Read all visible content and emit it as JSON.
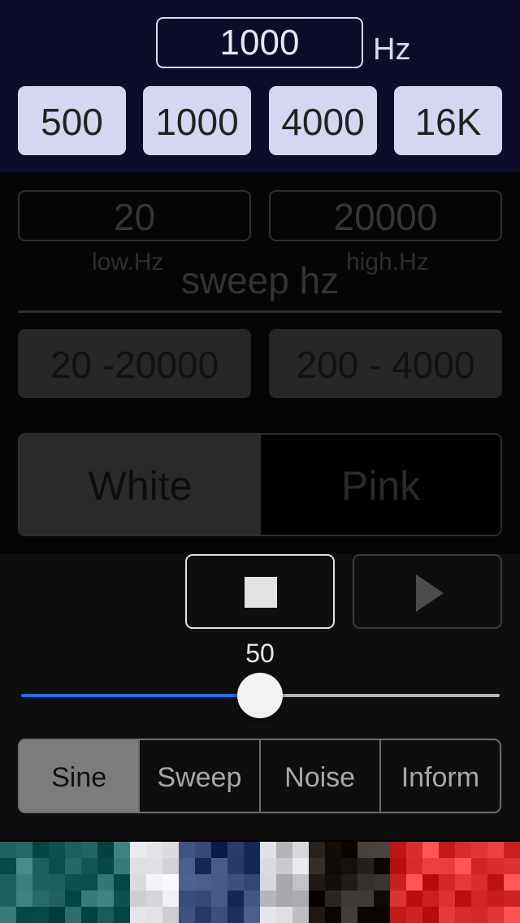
{
  "frequency": {
    "value": "1000",
    "unit": "Hz",
    "presets": [
      "500",
      "1000",
      "4000",
      "16K"
    ]
  },
  "sweep": {
    "low_value": "20",
    "high_value": "20000",
    "low_caption": "low.Hz",
    "high_caption": "high.Hz",
    "title": "sweep hz",
    "presets": [
      "20 -20000",
      "200 - 4000"
    ]
  },
  "noise": {
    "options": [
      "White",
      "Pink"
    ],
    "selected": "White"
  },
  "playback": {
    "stop_icon": "stop-icon",
    "play_icon": "play-icon"
  },
  "volume": {
    "value": "50",
    "level": 0.5
  },
  "modes": {
    "tabs": [
      "Sine",
      "Sweep",
      "Noise",
      "Inform"
    ],
    "selected": "Sine"
  },
  "colors": {
    "accent": "#1f70e5",
    "top_bg": "#0b0d2b",
    "preset_bg": "#d4d6f2"
  }
}
